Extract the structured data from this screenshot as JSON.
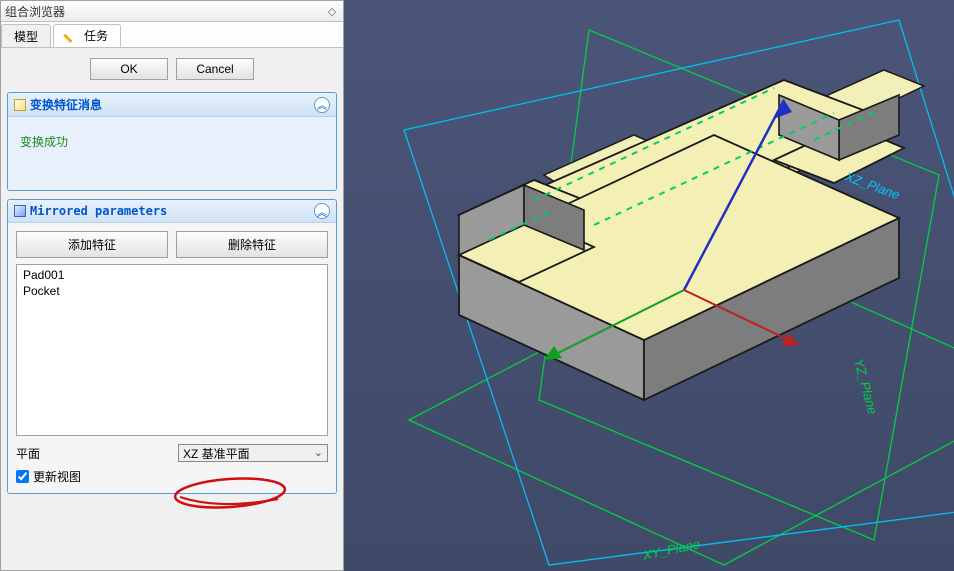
{
  "panel": {
    "title": "组合浏览器"
  },
  "tabs": {
    "model": "模型",
    "task": "任务"
  },
  "dialog": {
    "ok": "OK",
    "cancel": "Cancel"
  },
  "msg_group": {
    "title": "变换特征消息",
    "text": "变换成功"
  },
  "param_group": {
    "title": "Mirrored parameters",
    "add_feature": "添加特征",
    "remove_feature": "删除特征",
    "features": [
      "Pad001",
      "Pocket"
    ],
    "plane_label": "平面",
    "plane_value": "XZ 基准平面",
    "update_view": "更新视图"
  },
  "viewport": {
    "planes": [
      "XY_Plane",
      "XZ_Plane",
      "YZ_Plane"
    ]
  }
}
